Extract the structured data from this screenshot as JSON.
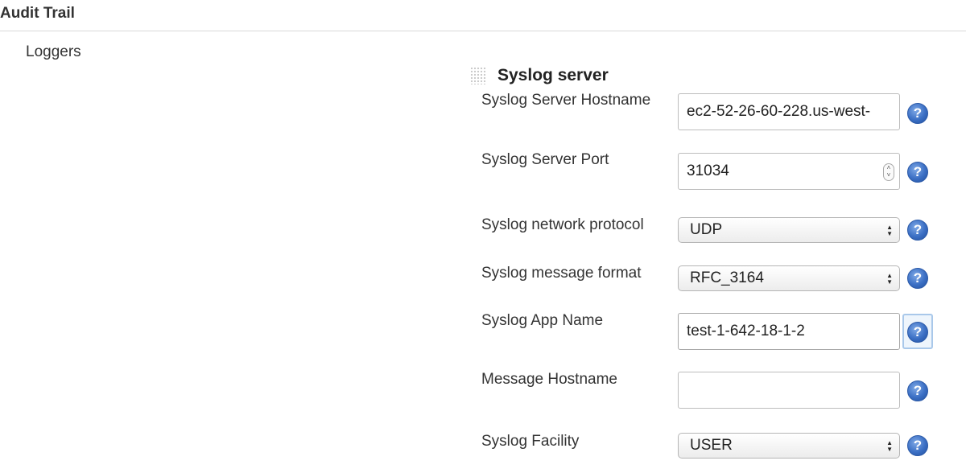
{
  "section": {
    "title": "Audit Trail"
  },
  "loggers": {
    "label": "Loggers"
  },
  "syslog": {
    "title": "Syslog server",
    "fields": {
      "hostname": {
        "label": "Syslog Server Hostname",
        "value": "ec2-52-26-60-228.us-west-"
      },
      "port": {
        "label": "Syslog Server Port",
        "value": "31034"
      },
      "protocol": {
        "label": "Syslog network protocol",
        "value": "UDP"
      },
      "format": {
        "label": "Syslog message format",
        "value": "RFC_3164"
      },
      "app_name": {
        "label": "Syslog App Name",
        "value": "test-1-642-18-1-2"
      },
      "message_hostname": {
        "label": "Message Hostname",
        "value": ""
      },
      "facility": {
        "label": "Syslog Facility",
        "value": "USER"
      }
    }
  },
  "icons": {
    "help": "help-icon",
    "drag": "drag-handle-icon",
    "select_arrows": "select-arrows-icon",
    "stepper": "number-stepper-icon"
  },
  "glyphs": {
    "help": "?",
    "select_arrows": "▲▼",
    "stepper_up": "˄",
    "stepper_down": "˅"
  },
  "colors": {
    "help_icon": "#3b6fc4",
    "focus_ring": "#a9c8ea",
    "divider": "#d9d9d9"
  }
}
